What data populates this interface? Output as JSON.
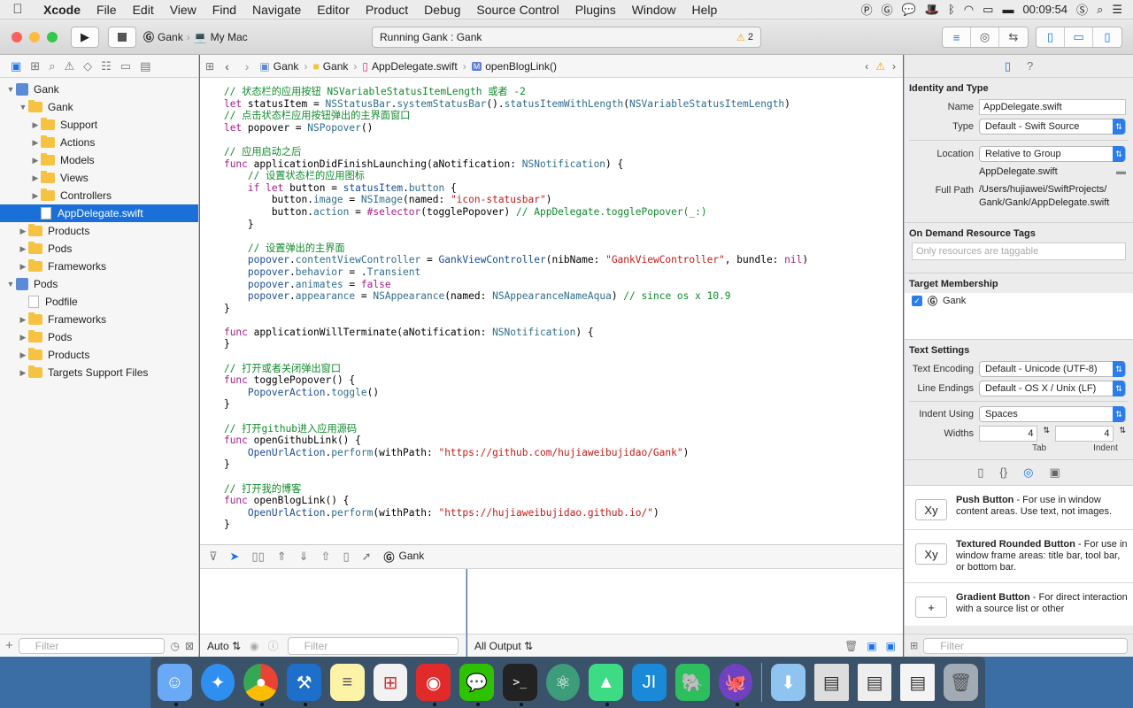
{
  "menubar": {
    "app": "Xcode",
    "items": [
      "File",
      "Edit",
      "View",
      "Find",
      "Navigate",
      "Editor",
      "Product",
      "Debug",
      "Source Control",
      "Plugins",
      "Window",
      "Help"
    ],
    "clock": "00:09:54"
  },
  "toolbar": {
    "scheme": "Gank",
    "device": "My Mac",
    "activity": "Running Gank : Gank",
    "warnings": "2"
  },
  "navigator": {
    "tree": [
      {
        "label": "Gank",
        "level": 0,
        "type": "project",
        "open": true
      },
      {
        "label": "Gank",
        "level": 1,
        "type": "folder",
        "open": true
      },
      {
        "label": "Support",
        "level": 2,
        "type": "folder"
      },
      {
        "label": "Actions",
        "level": 2,
        "type": "folder"
      },
      {
        "label": "Models",
        "level": 2,
        "type": "folder"
      },
      {
        "label": "Views",
        "level": 2,
        "type": "folder"
      },
      {
        "label": "Controllers",
        "level": 2,
        "type": "folder"
      },
      {
        "label": "AppDelegate.swift",
        "level": 2,
        "type": "file",
        "selected": true
      },
      {
        "label": "Products",
        "level": 1,
        "type": "folder"
      },
      {
        "label": "Pods",
        "level": 1,
        "type": "folder"
      },
      {
        "label": "Frameworks",
        "level": 1,
        "type": "folder"
      },
      {
        "label": "Pods",
        "level": 0,
        "type": "project",
        "open": true
      },
      {
        "label": "Podfile",
        "level": 1,
        "type": "file"
      },
      {
        "label": "Frameworks",
        "level": 1,
        "type": "folder"
      },
      {
        "label": "Pods",
        "level": 1,
        "type": "folder"
      },
      {
        "label": "Products",
        "level": 1,
        "type": "folder"
      },
      {
        "label": "Targets Support Files",
        "level": 1,
        "type": "folder"
      }
    ],
    "filter_placeholder": "Filter"
  },
  "jumpbar": {
    "crumbs": [
      "Gank",
      "Gank",
      "AppDelegate.swift",
      "openBlogLink()"
    ]
  },
  "code": [
    [
      [
        "    // 状态栏的应用按钮 NSVariableStatusItemLength 或者 -2",
        "cm"
      ]
    ],
    [
      [
        "    ",
        "p"
      ],
      [
        "let",
        "kw"
      ],
      [
        " statusItem = ",
        "p"
      ],
      [
        "NSStatusBar",
        "ty"
      ],
      [
        ".",
        "p"
      ],
      [
        "systemStatusBar",
        "ty"
      ],
      [
        "().",
        "p"
      ],
      [
        "statusItemWithLength",
        "ty"
      ],
      [
        "(",
        "p"
      ],
      [
        "NSVariableStatusItemLength",
        "ty"
      ],
      [
        ")",
        "p"
      ]
    ],
    [
      [
        "    // 点击状态栏应用按钮弹出的主界面窗口",
        "cm"
      ]
    ],
    [
      [
        "    ",
        "p"
      ],
      [
        "let",
        "kw"
      ],
      [
        " popover = ",
        "p"
      ],
      [
        "NSPopover",
        "ty"
      ],
      [
        "()",
        "p"
      ]
    ],
    [
      [
        "",
        ""
      ]
    ],
    [
      [
        "    // 应用启动之后",
        "cm"
      ]
    ],
    [
      [
        "    ",
        "p"
      ],
      [
        "func",
        "kw"
      ],
      [
        " applicationDidFinishLaunching(aNotification: ",
        "p"
      ],
      [
        "NSNotification",
        "ty"
      ],
      [
        ") {",
        "p"
      ]
    ],
    [
      [
        "        // 设置状态栏的应用图标",
        "cm"
      ]
    ],
    [
      [
        "        ",
        "p"
      ],
      [
        "if",
        "kw"
      ],
      [
        " ",
        "p"
      ],
      [
        "let",
        "kw"
      ],
      [
        " button = ",
        "p"
      ],
      [
        "statusItem",
        "tyb"
      ],
      [
        ".",
        "p"
      ],
      [
        "button",
        "ty"
      ],
      [
        " {",
        "p"
      ]
    ],
    [
      [
        "            button.",
        "p"
      ],
      [
        "image",
        "ty"
      ],
      [
        " = ",
        "p"
      ],
      [
        "NSImage",
        "ty"
      ],
      [
        "(named: ",
        "p"
      ],
      [
        "\"icon-statusbar\"",
        "st"
      ],
      [
        ")",
        "p"
      ]
    ],
    [
      [
        "            button.",
        "p"
      ],
      [
        "action",
        "ty"
      ],
      [
        " = ",
        "p"
      ],
      [
        "#selector",
        "kw"
      ],
      [
        "(togglePopover) ",
        "p"
      ],
      [
        "// AppDelegate.togglePopover(_:)",
        "cm"
      ]
    ],
    [
      [
        "        }",
        "p"
      ]
    ],
    [
      [
        "",
        ""
      ]
    ],
    [
      [
        "        // 设置弹出的主界面",
        "cm"
      ]
    ],
    [
      [
        "        ",
        "p"
      ],
      [
        "popover",
        "tyb"
      ],
      [
        ".",
        "p"
      ],
      [
        "contentViewController",
        "ty"
      ],
      [
        " = ",
        "p"
      ],
      [
        "GankViewController",
        "tyb"
      ],
      [
        "(nibName: ",
        "p"
      ],
      [
        "\"GankViewController\"",
        "st"
      ],
      [
        ", bundle: ",
        "p"
      ],
      [
        "nil",
        "kw"
      ],
      [
        ")",
        "p"
      ]
    ],
    [
      [
        "        ",
        "p"
      ],
      [
        "popover",
        "tyb"
      ],
      [
        ".",
        "p"
      ],
      [
        "behavior",
        "ty"
      ],
      [
        " = .",
        "p"
      ],
      [
        "Transient",
        "ty"
      ]
    ],
    [
      [
        "        ",
        "p"
      ],
      [
        "popover",
        "tyb"
      ],
      [
        ".",
        "p"
      ],
      [
        "animates",
        "ty"
      ],
      [
        " = ",
        "p"
      ],
      [
        "false",
        "kw"
      ]
    ],
    [
      [
        "        ",
        "p"
      ],
      [
        "popover",
        "tyb"
      ],
      [
        ".",
        "p"
      ],
      [
        "appearance",
        "ty"
      ],
      [
        " = ",
        "p"
      ],
      [
        "NSAppearance",
        "ty"
      ],
      [
        "(named: ",
        "p"
      ],
      [
        "NSAppearanceNameAqua",
        "ty"
      ],
      [
        ") ",
        "p"
      ],
      [
        "// since os x 10.9",
        "cm"
      ]
    ],
    [
      [
        "    }",
        "p"
      ]
    ],
    [
      [
        "",
        ""
      ]
    ],
    [
      [
        "    ",
        "p"
      ],
      [
        "func",
        "kw"
      ],
      [
        " applicationWillTerminate(aNotification: ",
        "p"
      ],
      [
        "NSNotification",
        "ty"
      ],
      [
        ") {",
        "p"
      ]
    ],
    [
      [
        "    }",
        "p"
      ]
    ],
    [
      [
        "",
        ""
      ]
    ],
    [
      [
        "    // 打开或者关闭弹出窗口",
        "cm"
      ]
    ],
    [
      [
        "    ",
        "p"
      ],
      [
        "func",
        "kw"
      ],
      [
        " togglePopover() {",
        "p"
      ]
    ],
    [
      [
        "        ",
        "p"
      ],
      [
        "PopoverAction",
        "tyb"
      ],
      [
        ".",
        "p"
      ],
      [
        "toggle",
        "ty"
      ],
      [
        "()",
        "p"
      ]
    ],
    [
      [
        "    }",
        "p"
      ]
    ],
    [
      [
        "",
        ""
      ]
    ],
    [
      [
        "    // 打开github进入应用源码",
        "cm"
      ]
    ],
    [
      [
        "    ",
        "p"
      ],
      [
        "func",
        "kw"
      ],
      [
        " openGithubLink() {",
        "p"
      ]
    ],
    [
      [
        "        ",
        "p"
      ],
      [
        "OpenUrlAction",
        "tyb"
      ],
      [
        ".",
        "p"
      ],
      [
        "perform",
        "ty"
      ],
      [
        "(withPath: ",
        "p"
      ],
      [
        "\"https://github.com/hujiaweibujidao/Gank\"",
        "st"
      ],
      [
        ")",
        "p"
      ]
    ],
    [
      [
        "    }",
        "p"
      ]
    ],
    [
      [
        "",
        ""
      ]
    ],
    [
      [
        "    // 打开我的博客",
        "cm"
      ]
    ],
    [
      [
        "    ",
        "p"
      ],
      [
        "func",
        "kw"
      ],
      [
        " openBlogLink() {",
        "p"
      ]
    ],
    [
      [
        "        ",
        "p"
      ],
      [
        "OpenUrlAction",
        "tyb"
      ],
      [
        ".",
        "p"
      ],
      [
        "perform",
        "ty"
      ],
      [
        "(withPath: ",
        "p"
      ],
      [
        "\"https://hujiaweibujidao.github.io/\"",
        "st"
      ],
      [
        ")",
        "p"
      ]
    ],
    [
      [
        "    }",
        "p"
      ]
    ]
  ],
  "debugbar": {
    "target": "Gank"
  },
  "console": {
    "left_mode": "Auto",
    "left_filter": "Filter",
    "right_mode": "All Output",
    "right_filter": "Filter"
  },
  "inspector": {
    "identity_title": "Identity and Type",
    "name_label": "Name",
    "name_value": "AppDelegate.swift",
    "type_label": "Type",
    "type_value": "Default - Swift Source",
    "location_label": "Location",
    "location_value": "Relative to Group",
    "location_file": "AppDelegate.swift",
    "fullpath_label": "Full Path",
    "fullpath_value": "/Users/hujiawei/SwiftProjects/Gank/Gank/AppDelegate.swift",
    "odr_title": "On Demand Resource Tags",
    "odr_placeholder": "Only resources are taggable",
    "target_title": "Target Membership",
    "target_name": "Gank",
    "text_title": "Text Settings",
    "encoding_label": "Text Encoding",
    "encoding_value": "Default - Unicode (UTF-8)",
    "endings_label": "Line Endings",
    "endings_value": "Default - OS X / Unix (LF)",
    "indent_label": "Indent Using",
    "indent_value": "Spaces",
    "widths_label": "Widths",
    "tab_value": "4",
    "tab_label": "Tab",
    "indent_width_value": "4",
    "indent_width_label": "Indent",
    "library": [
      {
        "icon": "Xy",
        "title": "Push Button",
        "desc": " - For use in window content areas. Use text, not images."
      },
      {
        "icon": "Xy",
        "title": "Textured Rounded Button",
        "desc": " - For use in window frame areas: title bar, tool bar, or bottom bar."
      },
      {
        "icon": "+",
        "title": "Gradient Button",
        "desc": " - For direct interaction with a source list or other"
      }
    ],
    "filter_placeholder": "Filter"
  },
  "dock": [
    "finder",
    "safari",
    "chrome",
    "xcode",
    "notes",
    "launchpad",
    "netease-music",
    "wechat",
    "terminal",
    "atom",
    "android-studio",
    "jetbrains",
    "evernote",
    "github",
    "downloads",
    "window1",
    "window2",
    "window3",
    "trash"
  ]
}
